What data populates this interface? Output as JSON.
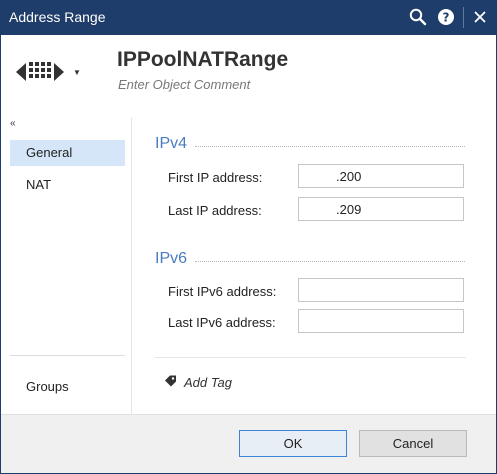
{
  "window": {
    "title": "Address Range",
    "icons": [
      "search-icon",
      "help-icon",
      "close-icon"
    ]
  },
  "header": {
    "object_name": "IPPoolNATRange",
    "comment_placeholder": "Enter Object Comment",
    "object_icon": "address-range-icon"
  },
  "sidebar": {
    "collapse_glyph": "«",
    "items": [
      {
        "label": "General",
        "active": true
      },
      {
        "label": "NAT",
        "active": false
      }
    ],
    "bottom_item": "Groups"
  },
  "ipv4": {
    "title": "IPv4",
    "first_label": "First IP address:",
    "first_value": ".200",
    "last_label": "Last IP address:",
    "last_value": ".209"
  },
  "ipv6": {
    "title": "IPv6",
    "first_label": "First IPv6 address:",
    "first_value": "",
    "last_label": "Last IPv6 address:",
    "last_value": ""
  },
  "tags": {
    "add_label": "Add Tag",
    "icon": "tag-icon"
  },
  "footer": {
    "ok_label": "OK",
    "cancel_label": "Cancel"
  },
  "colors": {
    "titlebar": "#1f3d6a",
    "section_title": "#4a7cbf",
    "nav_active": "#d4e6f8",
    "ok_border": "#3c84d6"
  }
}
